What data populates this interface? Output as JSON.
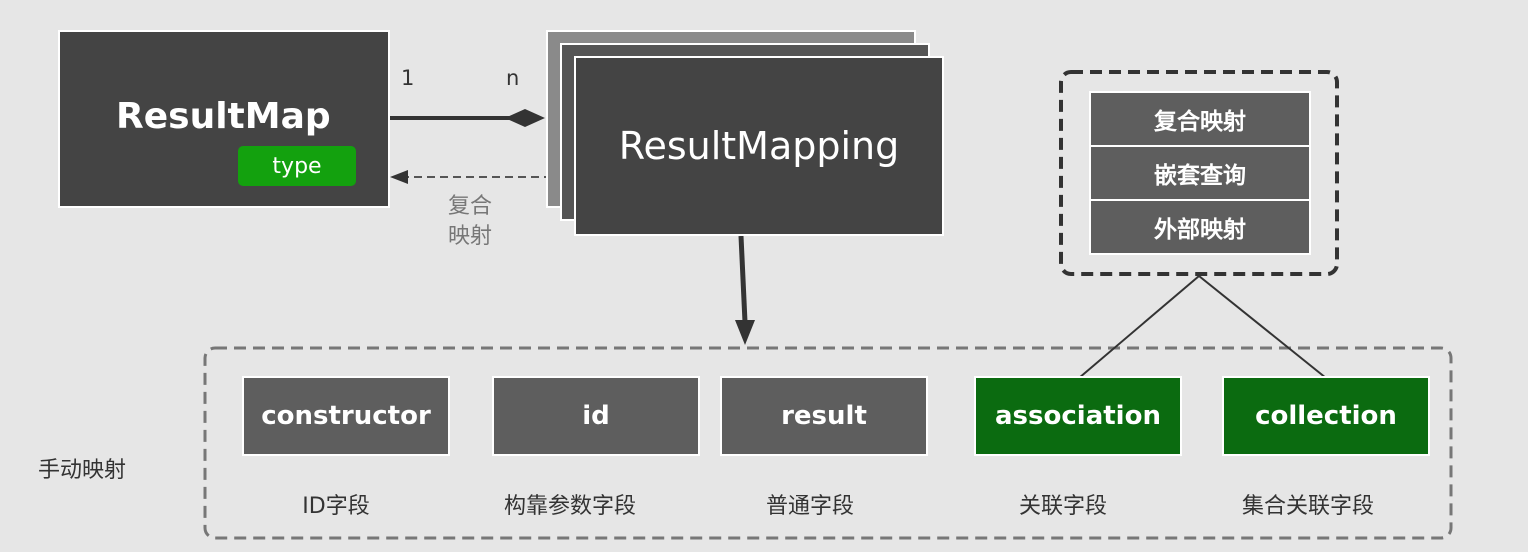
{
  "result_map": {
    "title": "ResultMap",
    "badge": "type"
  },
  "relation": {
    "left_multiplicity": "1",
    "right_multiplicity": "n",
    "back_label_line1": "复合",
    "back_label_line2": "映射"
  },
  "result_mapping": {
    "title": "ResultMapping"
  },
  "mapping_types": [
    {
      "label": "复合映射"
    },
    {
      "label": "嵌套查询"
    },
    {
      "label": "外部映射"
    }
  ],
  "manual_mapping": {
    "label": "手动映射",
    "fields": [
      {
        "label": "constructor",
        "caption": "ID字段",
        "color": "#5e5e5e"
      },
      {
        "label": "id",
        "caption": "构靠参数字段",
        "color": "#5e5e5e"
      },
      {
        "label": "result",
        "caption": "普通字段",
        "color": "#5e5e5e"
      },
      {
        "label": "association",
        "caption": "关联字段",
        "color": "#0b6b10"
      },
      {
        "label": "collection",
        "caption": "集合关联字段",
        "color": "#0b6b10"
      }
    ]
  },
  "colors": {
    "background": "#e6e6e6",
    "dark_box": "#444444",
    "green_badge": "#13a10e",
    "green_field": "#0b6b10",
    "gray_field": "#5e5e5e"
  }
}
